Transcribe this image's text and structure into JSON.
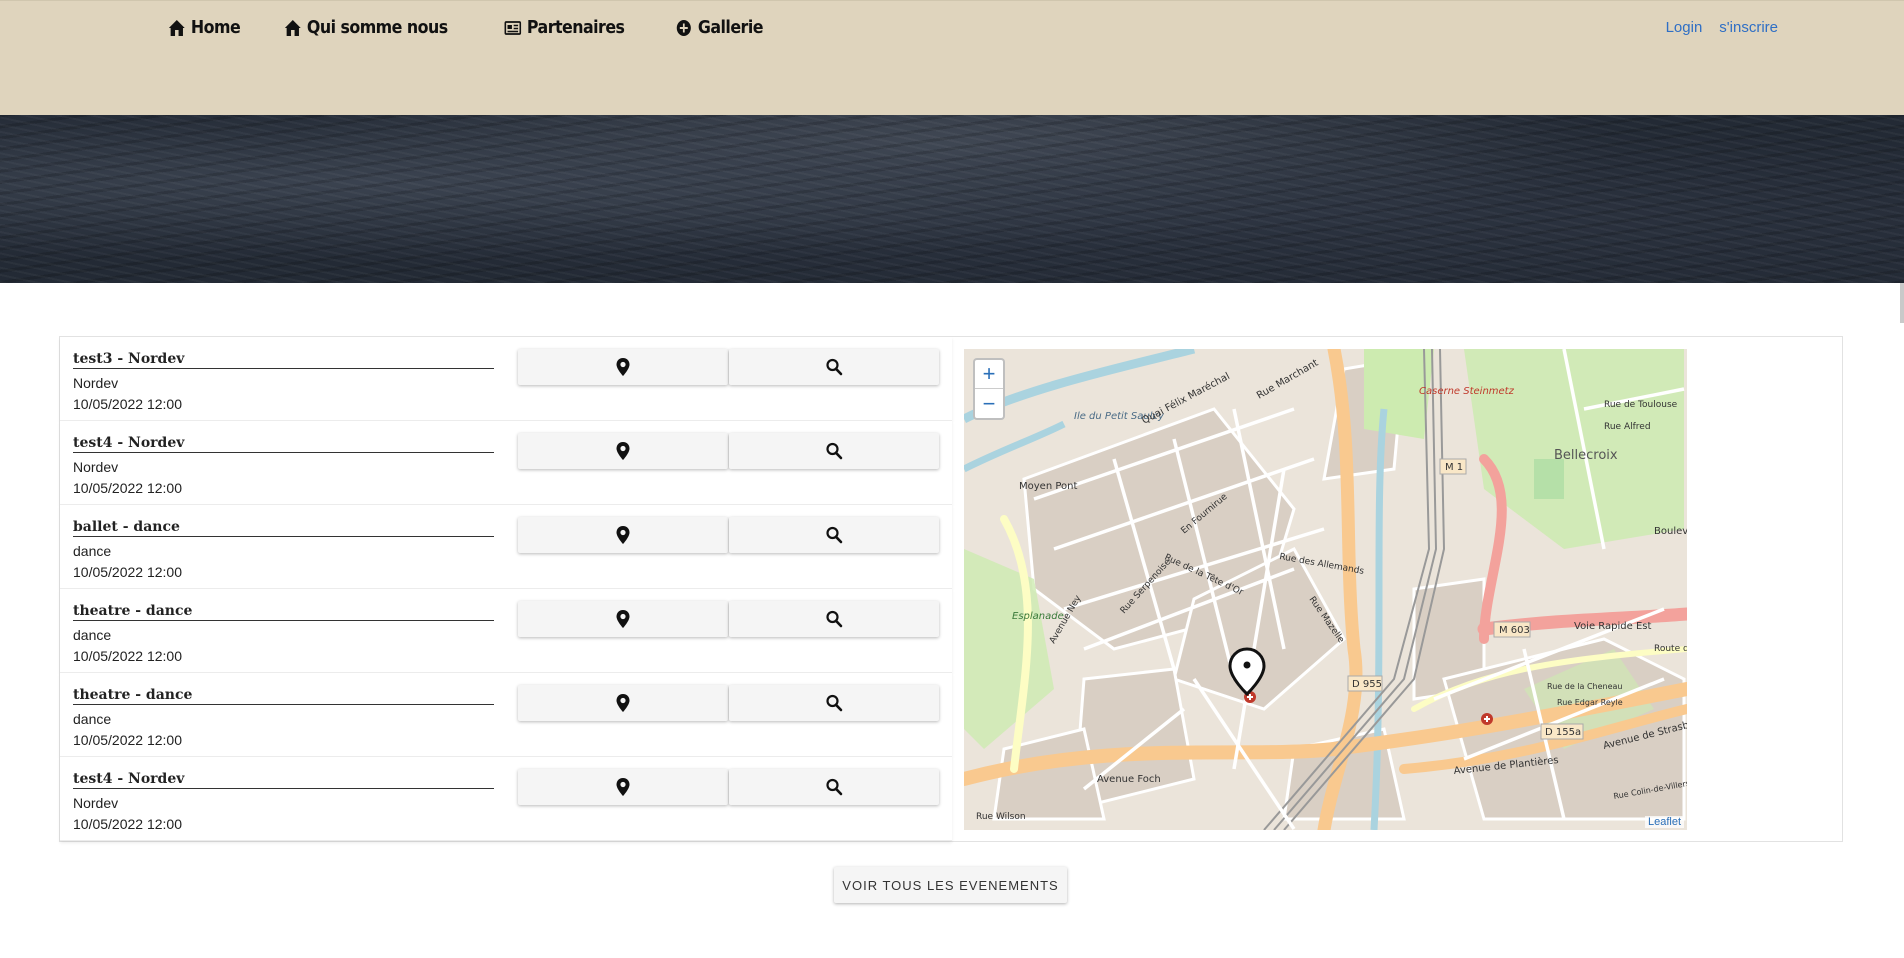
{
  "nav": {
    "home": "Home",
    "about": "Qui somme nous",
    "partners": "Partenaires",
    "gallery": "Gallerie"
  },
  "auth": {
    "login": "Login",
    "signup": "s'inscrire"
  },
  "events": [
    {
      "title": "test3 - Nordev",
      "category": "Nordev",
      "date": "10/05/2022 12:00"
    },
    {
      "title": "test4 - Nordev",
      "category": "Nordev",
      "date": "10/05/2022 12:00"
    },
    {
      "title": "ballet - dance",
      "category": "dance",
      "date": "10/05/2022 12:00"
    },
    {
      "title": "theatre - dance",
      "category": "dance",
      "date": "10/05/2022 12:00"
    },
    {
      "title": "theatre - dance",
      "category": "dance",
      "date": "10/05/2022 12:00"
    },
    {
      "title": "test4 - Nordev",
      "category": "Nordev",
      "date": "10/05/2022 12:00"
    }
  ],
  "icons": {
    "marker": "map-marker-icon",
    "view": "search-icon"
  },
  "map": {
    "zoom_in": "+",
    "zoom_out": "−",
    "attribution": "Leaflet",
    "labels": {
      "l1": "Ile du Petit Saulcy",
      "l2": "Quai Félix Maréchal",
      "l3": "Moyen Pont",
      "l4": "Rue Marchant",
      "l5": "Caserne Steinmetz",
      "l6": "Bellecroix",
      "l7": "Rue Alfred",
      "l8": "Rue de Toulouse",
      "l9": "Esplanade",
      "l10": "Rue Serpenoise",
      "l11": "Rue des Allemands",
      "l12": "Rue de la Tête d'Or",
      "l13": "En Fournirue",
      "l14": "Avenue Ney",
      "l15": "Rue Mazelle",
      "l16": "M 1",
      "l17": "M 603",
      "l18": "Voie Rapide Est",
      "l19": "D 955",
      "l20": "D 155a",
      "l21": "Avenue Foch",
      "l22": "Avenue de Plantières",
      "l23": "Avenue de Strasb",
      "l24": "Rue Wilson",
      "l25": "Rue de la Cheneau",
      "l26": "Rue Edgar Reyle",
      "l27": "Route de",
      "l28": "Boulev",
      "l29": "Rue Colin-de-Villers"
    }
  },
  "cta": "VOIR TOUS LES EVENEMENTS"
}
